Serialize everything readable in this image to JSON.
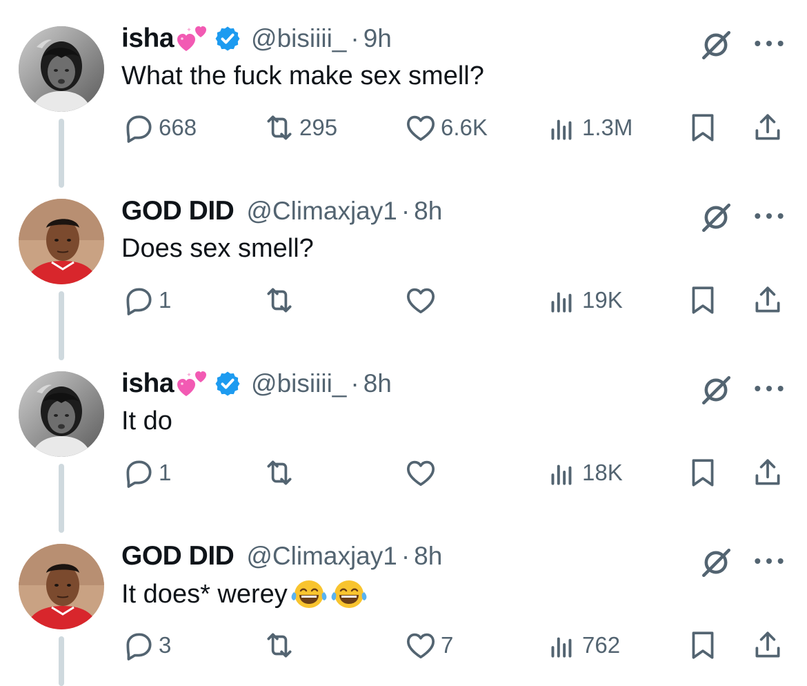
{
  "colors": {
    "text_primary": "#0f1419",
    "text_secondary": "#536471",
    "thread_line": "#cfd9de",
    "verified_blue": "#1d9bf0"
  },
  "icons": {
    "reply": "speech-bubble-icon",
    "repost": "repost-arrows-icon",
    "like": "heart-icon",
    "views": "bar-chart-icon",
    "bookmark": "bookmark-icon",
    "share": "share-upload-icon",
    "grok": "grok-slash-icon",
    "more": "ellipsis-icon",
    "verified": "verified-badge-icon",
    "name_emoji": "two-hearts-emoji",
    "laugh_emoji": "tears-of-joy-emoji"
  },
  "tweets": [
    {
      "name": "isha",
      "handle": "@bisiiii_",
      "dot": "·",
      "time": "9h",
      "text": "What the fuck make sex smell?",
      "verified": true,
      "stats": {
        "replies": "668",
        "reposts": "295",
        "likes": "6.6K",
        "views": "1.3M"
      }
    },
    {
      "name": "GOD DID",
      "handle": "@Climaxjay1",
      "dot": "·",
      "time": "8h",
      "text": "Does sex smell?",
      "verified": false,
      "stats": {
        "replies": "1",
        "reposts": "",
        "likes": "",
        "views": "19K"
      }
    },
    {
      "name": "isha",
      "handle": "@bisiiii_",
      "dot": "·",
      "time": "8h",
      "text": "It do",
      "verified": true,
      "stats": {
        "replies": "1",
        "reposts": "",
        "likes": "",
        "views": "18K"
      }
    },
    {
      "name": "GOD DID",
      "handle": "@Climaxjay1",
      "dot": "·",
      "time": "8h",
      "text": "It does* werey",
      "verified": false,
      "stats": {
        "replies": "3",
        "reposts": "",
        "likes": "7",
        "views": "762"
      }
    }
  ]
}
